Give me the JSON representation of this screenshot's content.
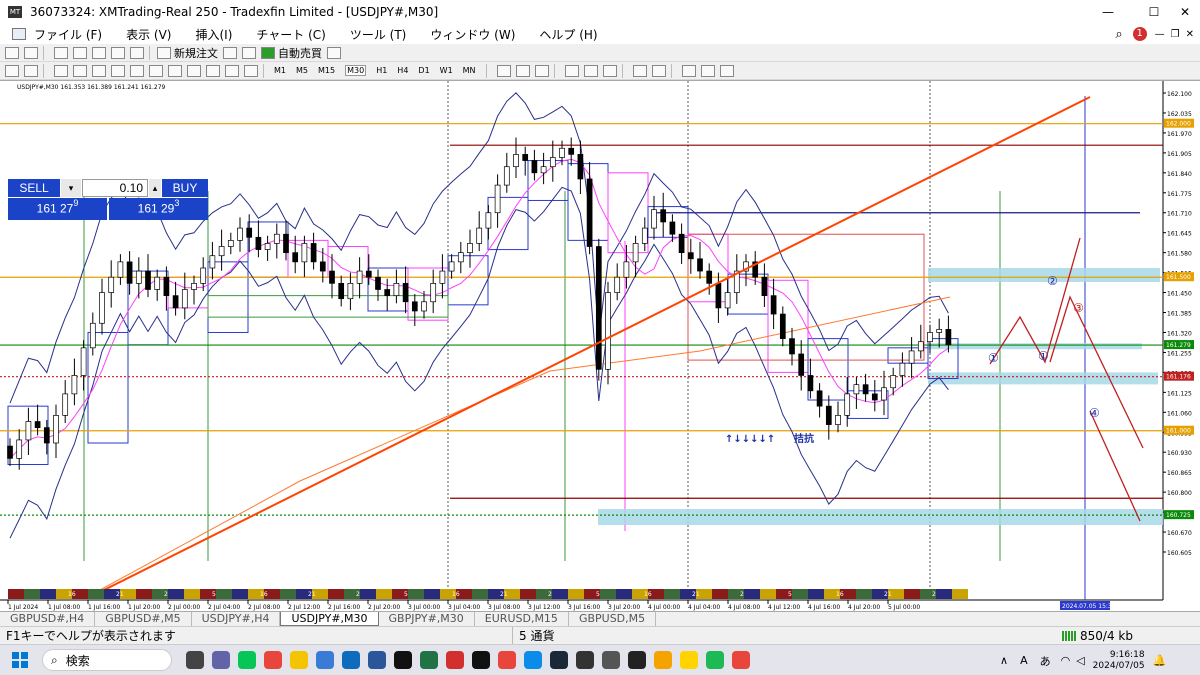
{
  "window": {
    "title": "36073324: XMTrading-Real 250 - Tradexfin Limited - [USDJPY#,M30]",
    "app_icon": "mt4-icon"
  },
  "menu": {
    "items": [
      "ファイル (F)",
      "表示 (V)",
      "挿入(I)",
      "チャート (C)",
      "ツール (T)",
      "ウィンドウ (W)",
      "ヘルプ (H)"
    ],
    "alert_count": "1"
  },
  "toolbar": {
    "new_order": "新規注文",
    "auto_trade": "自動売買"
  },
  "timeframes": [
    "M1",
    "M5",
    "M15",
    "M30",
    "H1",
    "H4",
    "D1",
    "W1",
    "MN"
  ],
  "active_timeframe": "M30",
  "chart": {
    "header": "USDJPY#,M30  161.353 161.389 161.241 161.279",
    "sell_label": "SELL",
    "buy_label": "BUY",
    "lot": "0.10",
    "sell_price_main": "161 27",
    "sell_price_sup": "9",
    "buy_price_main": "161 29",
    "buy_price_sup": "3",
    "price_labels": [
      "162.100",
      "162.035",
      "161.970",
      "161.905",
      "161.840",
      "161.775",
      "161.710",
      "161.645",
      "161.580",
      "161.515",
      "161.450",
      "161.385",
      "161.320",
      "161.255",
      "161.190",
      "161.125",
      "161.060",
      "160.995",
      "160.930",
      "160.865",
      "160.800",
      "160.735",
      "160.670",
      "160.605"
    ],
    "highlight_labels": [
      {
        "text": "162.000",
        "color": "#e6a100"
      },
      {
        "text": "161.500",
        "color": "#e6a100"
      },
      {
        "text": "161.279",
        "color": "#0a8a0a"
      },
      {
        "text": "161.176",
        "color": "#c02020"
      },
      {
        "text": "161.000",
        "color": "#e6a100"
      },
      {
        "text": "160.725",
        "color": "#0a8a0a"
      }
    ],
    "time_labels": [
      "1 Jul 2024",
      "1 Jul 08:00",
      "1 Jul 16:00",
      "1 Jul 20:00",
      "2 Jul 00:00",
      "2 Jul 04:00",
      "2 Jul 08:00",
      "2 Jul 12:00",
      "2 Jul 16:00",
      "2 Jul 20:00",
      "3 Jul 00:00",
      "3 Jul 04:00",
      "3 Jul 08:00",
      "3 Jul 12:00",
      "3 Jul 16:00",
      "3 Jul 20:00",
      "4 Jul 00:00",
      "4 Jul 04:00",
      "4 Jul 08:00",
      "4 Jul 12:00",
      "4 Jul 16:00",
      "4 Jul 20:00",
      "5 Jul 00:00"
    ],
    "cursor_time": "2024.07.05 15:30",
    "annotation_arrows": "↑↓↓↓↓↑",
    "annotation_text": "拮抗",
    "wave_labels": [
      "①",
      "①",
      "②",
      "③",
      "④"
    ],
    "session_numbers": [
      "16",
      "21",
      "2",
      "5",
      "16",
      "21",
      "2",
      "5",
      "16",
      "21",
      "2",
      "5",
      "16",
      "21",
      "2",
      "5",
      "16",
      "21",
      "2",
      "5"
    ]
  },
  "tabs": [
    "GBPUSD#,H4",
    "GBPUSD#,M5",
    "USDJPY#,H4",
    "USDJPY#,M30",
    "GBPJPY#,M30",
    "EURUSD,M15",
    "GBPUSD,M5"
  ],
  "active_tab": "USDJPY#,M30",
  "status": {
    "help": "F1キーでヘルプが表示されます",
    "profile": "5 通貨",
    "traffic": "850/4 kb"
  },
  "taskbar": {
    "search_placeholder": "検索",
    "time": "9:16:18",
    "date": "2024/07/05",
    "ime": "A",
    "icons": [
      "task-view-icon",
      "teams-icon",
      "line-icon",
      "chrome-icon",
      "norton-icon",
      "photos-icon",
      "mail-icon",
      "word-icon",
      "xm-icon",
      "excel-icon",
      "fx-icon",
      "chatgpt-icon",
      "chrome-icon",
      "edge-icon",
      "steam-icon",
      "app-icon",
      "app-icon",
      "lightning-icon",
      "sun-icon",
      "sticky-icon",
      "spotify-icon",
      "chrome-icon"
    ],
    "icon_colors": [
      "#444",
      "#6264a7",
      "#06c755",
      "#e8453c",
      "#f5c400",
      "#3a7bd5",
      "#0f6cbd",
      "#2b579a",
      "#111",
      "#217346",
      "#d32f2f",
      "#111",
      "#e8453c",
      "#0c8ce9",
      "#1b2838",
      "#333",
      "#555",
      "#222",
      "#f4a300",
      "#ffd400",
      "#1db954",
      "#e8453c"
    ]
  }
}
